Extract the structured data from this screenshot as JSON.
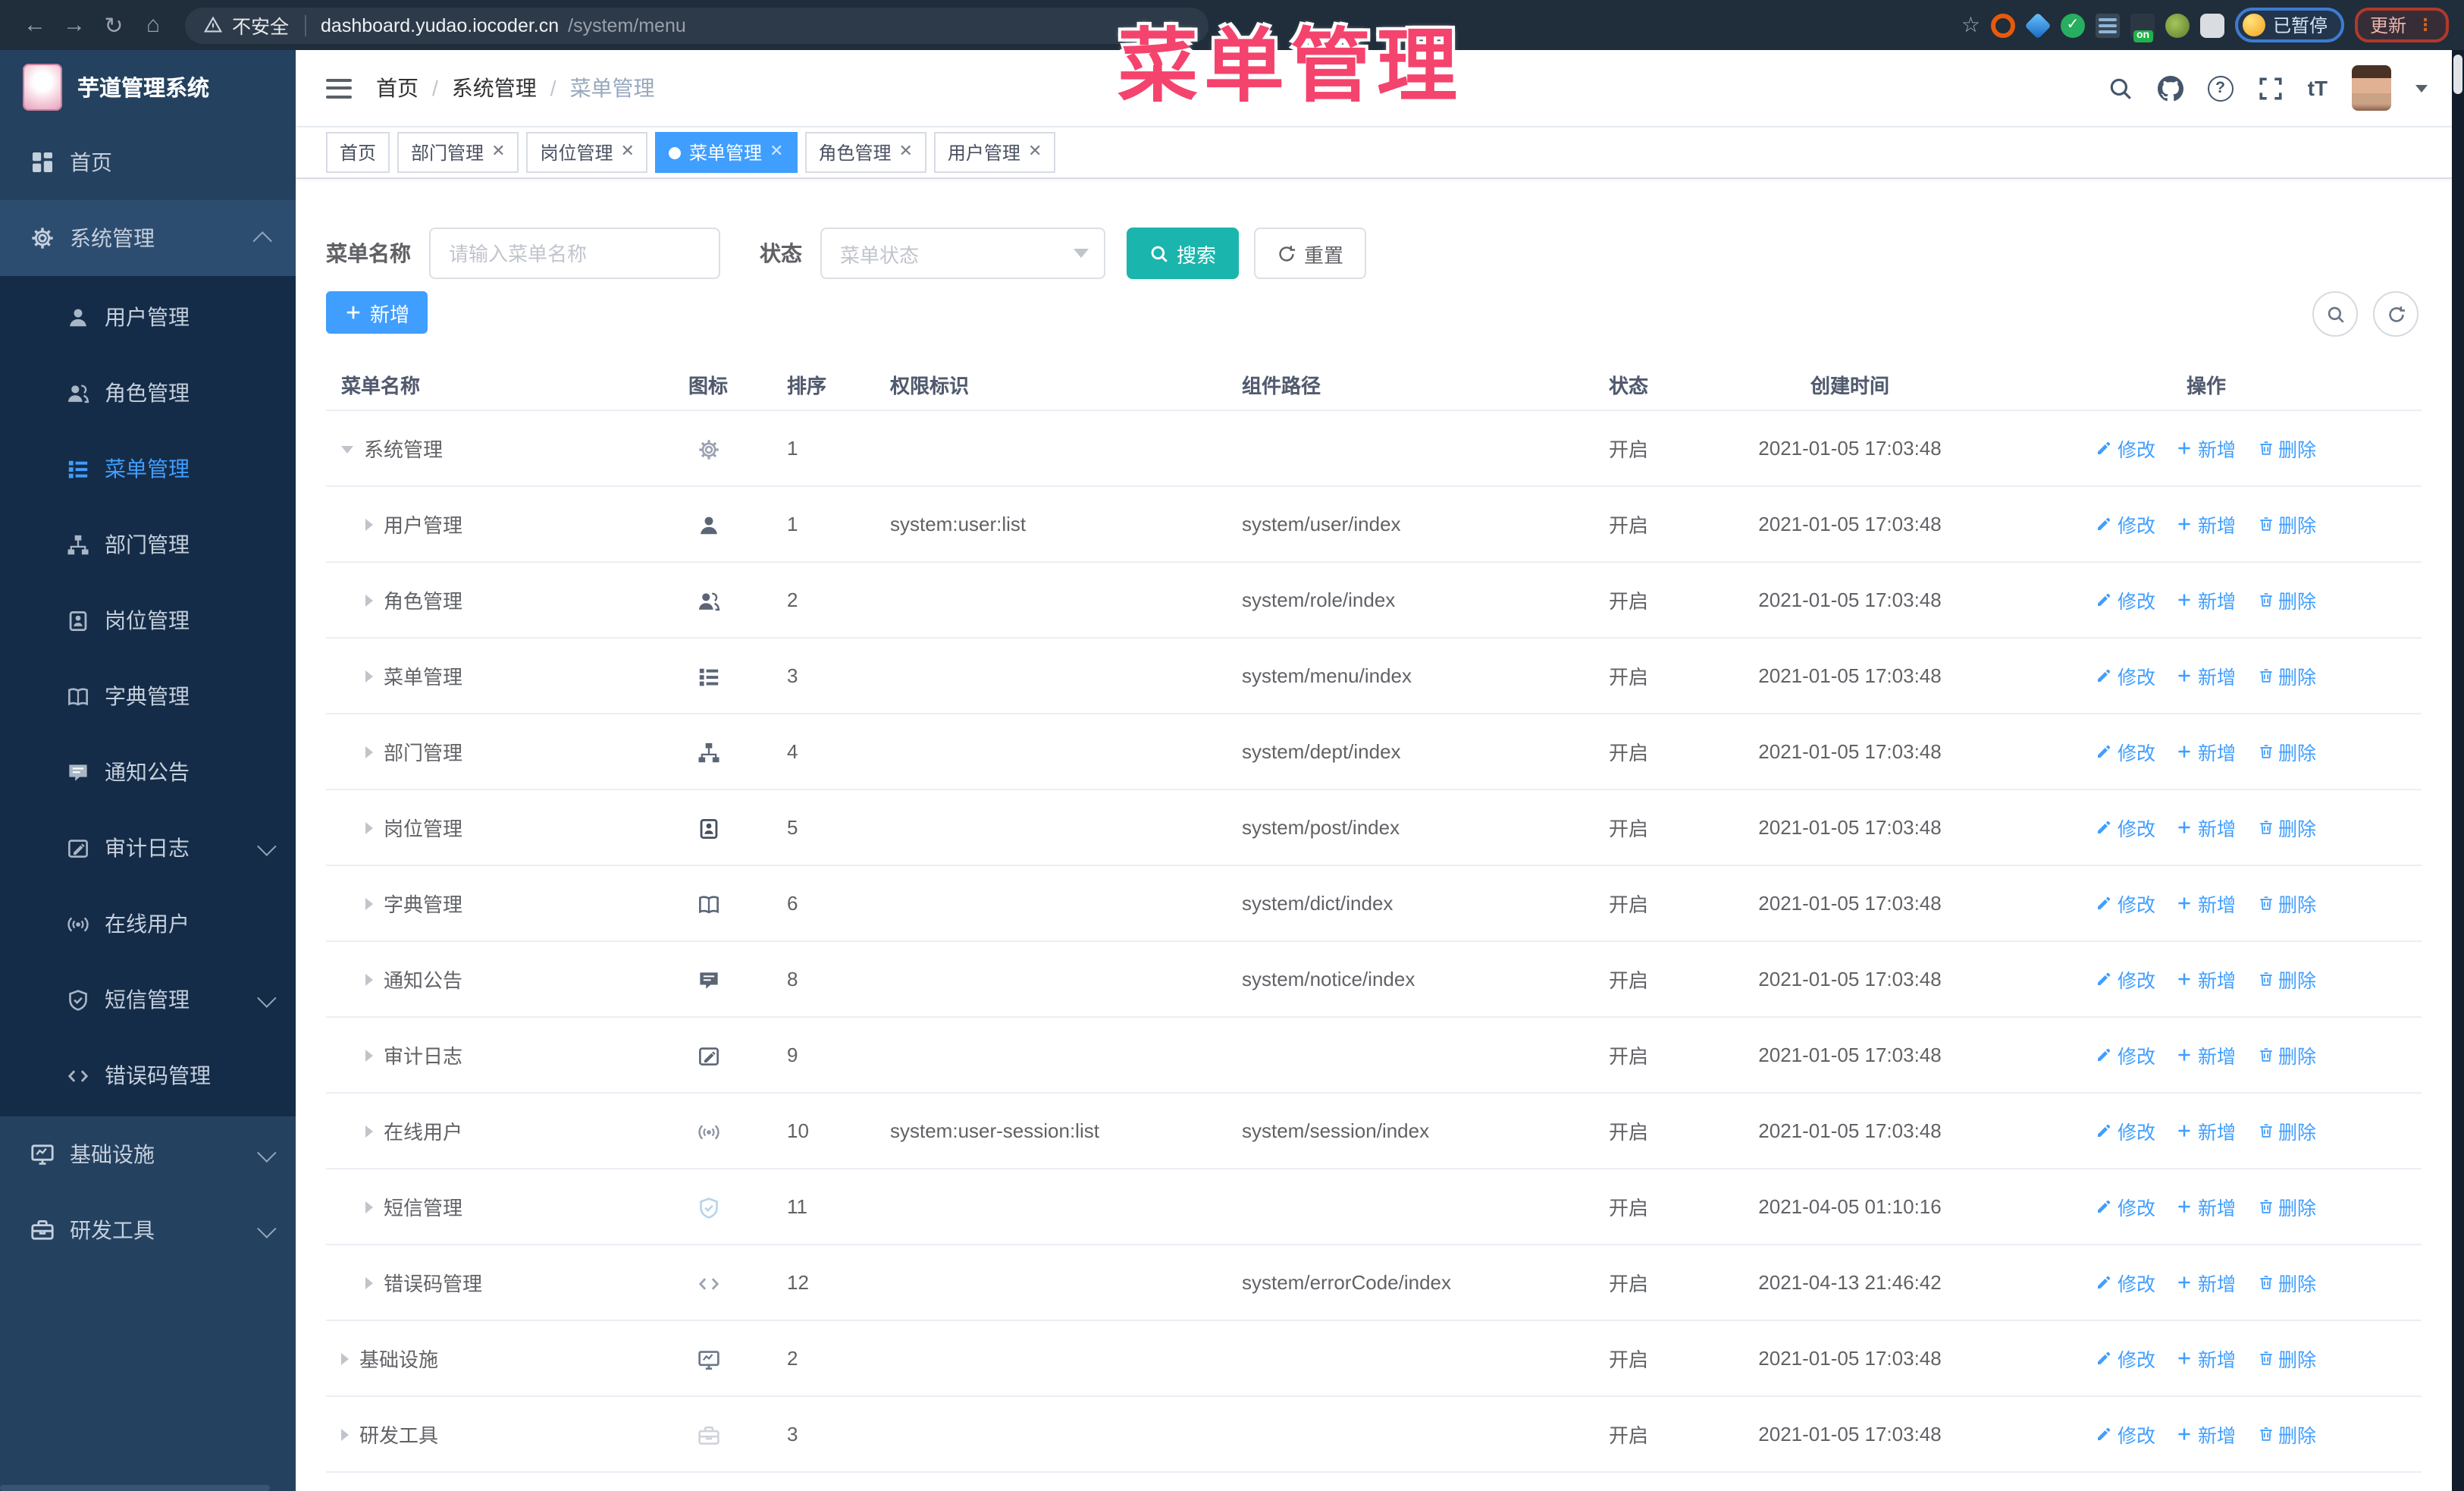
{
  "colors": {
    "primary": "#409eff",
    "search_button": "#1ab5ad",
    "annotation": "#f4436d",
    "sidebar_bg": "#24415f",
    "sidebar_submenu_bg": "#152c48",
    "tab_active_bg": "#409eff"
  },
  "chrome": {
    "security_label": "不安全",
    "url_host": "dashboard.yudao.iocoder.cn",
    "url_path": "/system/menu",
    "extension_badge": "on",
    "paused_label": "已暂停",
    "update_label": "更新"
  },
  "annotation": "菜单管理",
  "sidebar": {
    "logo_title": "芋道管理系统",
    "items": [
      {
        "key": "home",
        "icon": "dashboard",
        "label": "首页",
        "type": "top"
      },
      {
        "key": "system",
        "icon": "gear",
        "label": "系统管理",
        "type": "top",
        "active_parent": true,
        "caret": "up"
      },
      {
        "key": "user",
        "icon": "user",
        "label": "用户管理",
        "type": "sub"
      },
      {
        "key": "role",
        "icon": "users",
        "label": "角色管理",
        "type": "sub"
      },
      {
        "key": "menu",
        "icon": "menu",
        "label": "菜单管理",
        "type": "sub",
        "active": true
      },
      {
        "key": "dept",
        "icon": "tree",
        "label": "部门管理",
        "type": "sub"
      },
      {
        "key": "post",
        "icon": "badge",
        "label": "岗位管理",
        "type": "sub"
      },
      {
        "key": "dict",
        "icon": "book",
        "label": "字典管理",
        "type": "sub"
      },
      {
        "key": "notice",
        "icon": "comment",
        "label": "通知公告",
        "type": "sub"
      },
      {
        "key": "audit-log",
        "icon": "editlog",
        "label": "审计日志",
        "type": "sub",
        "caret": "down"
      },
      {
        "key": "online-user",
        "icon": "online",
        "label": "在线用户",
        "type": "sub"
      },
      {
        "key": "sms",
        "icon": "shield",
        "label": "短信管理",
        "type": "sub",
        "caret": "down"
      },
      {
        "key": "error-code",
        "icon": "code",
        "label": "错误码管理",
        "type": "sub"
      },
      {
        "key": "infra",
        "icon": "monitor",
        "label": "基础设施",
        "type": "top",
        "caret": "down"
      },
      {
        "key": "dev-tools",
        "icon": "toolbox",
        "label": "研发工具",
        "type": "top",
        "caret": "down"
      }
    ]
  },
  "breadcrumb": [
    "首页",
    "系统管理",
    "菜单管理"
  ],
  "tabs": [
    {
      "label": "首页",
      "closable": false,
      "active": false
    },
    {
      "label": "部门管理",
      "closable": true,
      "active": false
    },
    {
      "label": "岗位管理",
      "closable": true,
      "active": false
    },
    {
      "label": "菜单管理",
      "closable": true,
      "active": true
    },
    {
      "label": "角色管理",
      "closable": true,
      "active": false
    },
    {
      "label": "用户管理",
      "closable": true,
      "active": false
    }
  ],
  "header_tools": {
    "font_size_label": "tT",
    "help_glyph": "?"
  },
  "filters": {
    "name_label": "菜单名称",
    "name_placeholder": "请输入菜单名称",
    "status_label": "状态",
    "status_placeholder": "菜单状态",
    "search_label": "搜索",
    "reset_label": "重置"
  },
  "toolbar": {
    "add_label": "新增"
  },
  "table": {
    "headers": [
      "菜单名称",
      "图标",
      "排序",
      "权限标识",
      "组件路径",
      "状态",
      "创建时间",
      "操作"
    ],
    "action_labels": {
      "edit": "修改",
      "add": "新增",
      "delete": "删除"
    },
    "rows": [
      {
        "name": "系统管理",
        "icon": "gear",
        "icon_color": "#9aa3b0",
        "level": 0,
        "expand": "open",
        "order": "1",
        "perm": "",
        "path": "",
        "status": "开启",
        "time": "2021-01-05 17:03:48"
      },
      {
        "name": "用户管理",
        "icon": "user",
        "icon_color": "#5b6576",
        "level": 1,
        "expand": "closed",
        "order": "1",
        "perm": "system:user:list",
        "path": "system/user/index",
        "status": "开启",
        "time": "2021-01-05 17:03:48"
      },
      {
        "name": "角色管理",
        "icon": "users",
        "icon_color": "#5b6576",
        "level": 1,
        "expand": "closed",
        "order": "2",
        "perm": "",
        "path": "system/role/index",
        "status": "开启",
        "time": "2021-01-05 17:03:48"
      },
      {
        "name": "菜单管理",
        "icon": "menu",
        "icon_color": "#5b6576",
        "level": 1,
        "expand": "closed",
        "order": "3",
        "perm": "",
        "path": "system/menu/index",
        "status": "开启",
        "time": "2021-01-05 17:03:48"
      },
      {
        "name": "部门管理",
        "icon": "tree",
        "icon_color": "#5b6576",
        "level": 1,
        "expand": "closed",
        "order": "4",
        "perm": "",
        "path": "system/dept/index",
        "status": "开启",
        "time": "2021-01-05 17:03:48"
      },
      {
        "name": "岗位管理",
        "icon": "badge",
        "icon_color": "#454f61",
        "level": 1,
        "expand": "closed",
        "order": "5",
        "perm": "",
        "path": "system/post/index",
        "status": "开启",
        "time": "2021-01-05 17:03:48"
      },
      {
        "name": "字典管理",
        "icon": "book",
        "icon_color": "#5b6576",
        "level": 1,
        "expand": "closed",
        "order": "6",
        "perm": "",
        "path": "system/dict/index",
        "status": "开启",
        "time": "2021-01-05 17:03:48"
      },
      {
        "name": "通知公告",
        "icon": "comment",
        "icon_color": "#5b6576",
        "level": 1,
        "expand": "closed",
        "order": "8",
        "perm": "",
        "path": "system/notice/index",
        "status": "开启",
        "time": "2021-01-05 17:03:48"
      },
      {
        "name": "审计日志",
        "icon": "editlog",
        "icon_color": "#5b6576",
        "level": 1,
        "expand": "closed",
        "order": "9",
        "perm": "",
        "path": "",
        "status": "开启",
        "time": "2021-01-05 17:03:48"
      },
      {
        "name": "在线用户",
        "icon": "online",
        "icon_color": "#8a94a2",
        "level": 1,
        "expand": "closed",
        "order": "10",
        "perm": "system:user-session:list",
        "path": "system/session/index",
        "status": "开启",
        "time": "2021-01-05 17:03:48"
      },
      {
        "name": "短信管理",
        "icon": "shield",
        "icon_color": "#b7d3ea",
        "level": 1,
        "expand": "closed",
        "order": "11",
        "perm": "",
        "path": "",
        "status": "开启",
        "time": "2021-04-05 01:10:16"
      },
      {
        "name": "错误码管理",
        "icon": "code",
        "icon_color": "#9aa3b0",
        "level": 1,
        "expand": "closed",
        "order": "12",
        "perm": "",
        "path": "system/errorCode/index",
        "status": "开启",
        "time": "2021-04-13 21:46:42"
      },
      {
        "name": "基础设施",
        "icon": "monitor",
        "icon_color": "#6b7685",
        "level": 0,
        "expand": "closed",
        "order": "2",
        "perm": "",
        "path": "",
        "status": "开启",
        "time": "2021-01-05 17:03:48"
      },
      {
        "name": "研发工具",
        "icon": "toolbox",
        "icon_color": "#cfd4da",
        "level": 0,
        "expand": "closed",
        "order": "3",
        "perm": "",
        "path": "",
        "status": "开启",
        "time": "2021-01-05 17:03:48"
      }
    ]
  }
}
